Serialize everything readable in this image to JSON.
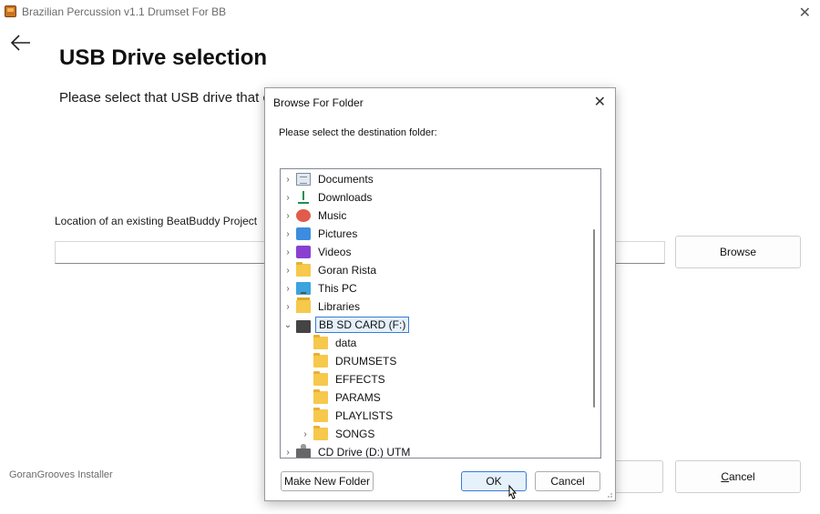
{
  "window": {
    "title": "Brazilian Percussion v1.1 Drumset For BB",
    "close_glyph": "✕"
  },
  "page": {
    "title": "USB Drive selection",
    "instruction": "Please select that USB drive that co",
    "location_label": "Location of an existing BeatBuddy Project",
    "path_value": "",
    "browse_label": "Browse",
    "footer": "GoranGrooves Installer",
    "cancel_label_u": "C",
    "cancel_label_rest": "ancel"
  },
  "dialog": {
    "title": "Browse For Folder",
    "close_glyph": "✕",
    "prompt": "Please select the destination folder:",
    "tree": [
      {
        "label": "Documents",
        "icon": "documents-icon",
        "chevron": "›",
        "depth": 0
      },
      {
        "label": "Downloads",
        "icon": "downloads-icon",
        "chevron": "›",
        "depth": 0
      },
      {
        "label": "Music",
        "icon": "music-icon",
        "chevron": "›",
        "depth": 0
      },
      {
        "label": "Pictures",
        "icon": "pictures-icon",
        "chevron": "›",
        "depth": 0
      },
      {
        "label": "Videos",
        "icon": "videos-icon",
        "chevron": "›",
        "depth": 0
      },
      {
        "label": "Goran Rista",
        "icon": "folder-icon",
        "chevron": "›",
        "depth": 0
      },
      {
        "label": "This PC",
        "icon": "pc-icon",
        "chevron": "›",
        "depth": 0
      },
      {
        "label": "Libraries",
        "icon": "libraries-icon",
        "chevron": "›",
        "depth": 0
      },
      {
        "label": "BB SD CARD (F:)",
        "icon": "drive-icon",
        "chevron": "⌄",
        "depth": 0,
        "selected": true
      },
      {
        "label": "data",
        "icon": "folder-icon",
        "chevron": "",
        "depth": 1
      },
      {
        "label": "DRUMSETS",
        "icon": "folder-icon",
        "chevron": "",
        "depth": 1
      },
      {
        "label": "EFFECTS",
        "icon": "folder-icon",
        "chevron": "",
        "depth": 1
      },
      {
        "label": "PARAMS",
        "icon": "folder-icon",
        "chevron": "",
        "depth": 1
      },
      {
        "label": "PLAYLISTS",
        "icon": "folder-icon",
        "chevron": "",
        "depth": 1
      },
      {
        "label": "SONGS",
        "icon": "folder-icon",
        "chevron": "›",
        "depth": 1
      },
      {
        "label": "CD Drive (D:) UTM",
        "icon": "cd-drive-icon",
        "chevron": "›",
        "depth": 0
      }
    ],
    "make_folder_label": "Make New Folder",
    "ok_label": "OK",
    "cancel_label": "Cancel"
  }
}
